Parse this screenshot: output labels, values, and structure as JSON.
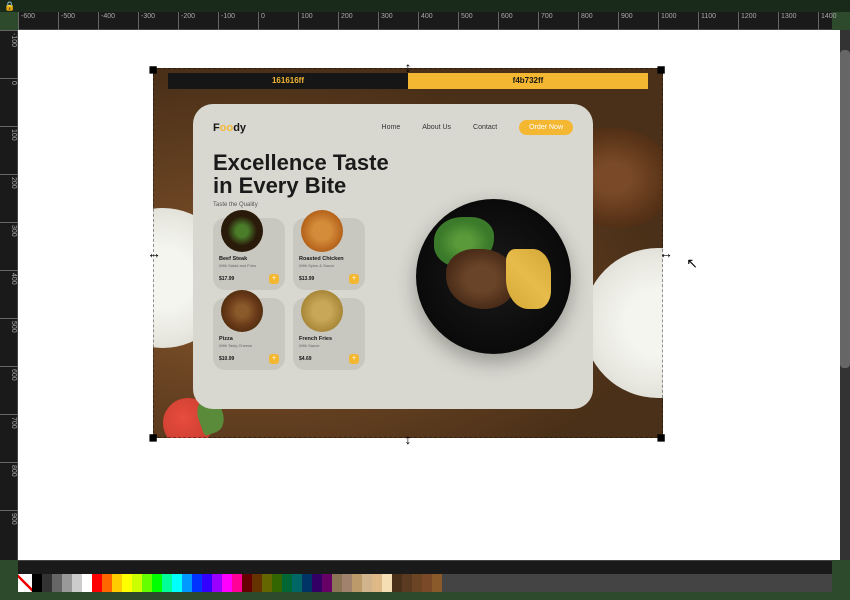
{
  "ruler_h": [
    "-600",
    "-500",
    "-400",
    "-300",
    "-200",
    "-100",
    "0",
    "100",
    "200",
    "300",
    "400",
    "500",
    "600",
    "700",
    "800",
    "900",
    "1000",
    "1100",
    "1200",
    "1300",
    "1400"
  ],
  "ruler_v": [
    "-100",
    "0",
    "100",
    "200",
    "300",
    "400",
    "500",
    "600",
    "700",
    "800",
    "900"
  ],
  "colorbar": {
    "dark_label": "161616ff",
    "yellow_label": "f4b732ff"
  },
  "card": {
    "logo": {
      "f": "F",
      "oo": "oo",
      "dy": "dy"
    },
    "nav": [
      "Home",
      "About Us",
      "Contact"
    ],
    "order_btn": "Order Now",
    "title_line1": "Excellence Taste",
    "title_line2": "in Every Bite",
    "subtitle": "Taste the Quality",
    "items": [
      {
        "name": "Beef Steak",
        "desc": "With Salad and Fries",
        "price": "$17.99"
      },
      {
        "name": "Roasted Chicken",
        "desc": "With Spice & Sauce",
        "price": "$13.99"
      },
      {
        "name": "Pizza",
        "desc": "With Tasty Cheese",
        "price": "$10.99"
      },
      {
        "name": "French Fries",
        "desc": "With Sauce",
        "price": "$4.69"
      }
    ]
  },
  "palette": [
    "#000000",
    "#333333",
    "#666666",
    "#999999",
    "#cccccc",
    "#ffffff",
    "#ff0000",
    "#ff6600",
    "#ffcc00",
    "#ffff00",
    "#ccff00",
    "#66ff00",
    "#00ff00",
    "#00ff99",
    "#00ffff",
    "#0099ff",
    "#0033ff",
    "#3300ff",
    "#9900ff",
    "#ff00ff",
    "#ff0099",
    "#660000",
    "#663300",
    "#666600",
    "#336600",
    "#006633",
    "#006666",
    "#003366",
    "#330066",
    "#660066",
    "#8b7355",
    "#a0826d",
    "#bc9a6a",
    "#d2b48c",
    "#deb887",
    "#f5deb3",
    "#4a3018",
    "#5a3a20",
    "#6b4423",
    "#7a4a28",
    "#8b5a2b"
  ]
}
